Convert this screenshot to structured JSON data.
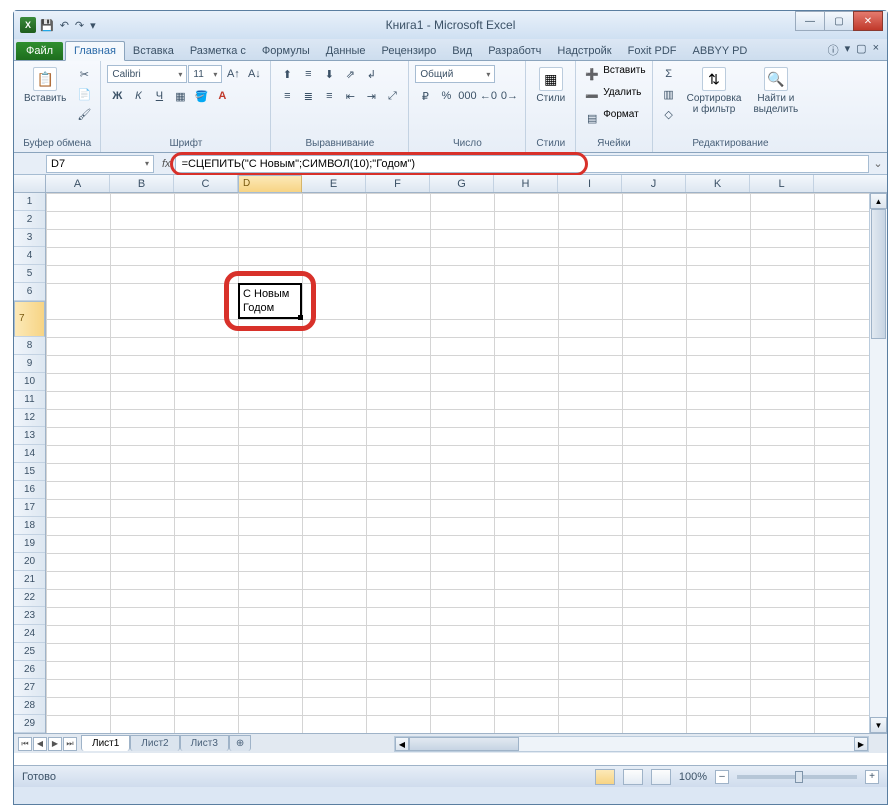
{
  "title": "Книга1 - Microsoft Excel",
  "qat": {
    "xl": "X",
    "save": "💾",
    "undo": "↶",
    "redo": "↷",
    "dd": "▾"
  },
  "tabs": {
    "file": "Файл",
    "items": [
      "Главная",
      "Вставка",
      "Разметка с",
      "Формулы",
      "Данные",
      "Рецензиро",
      "Вид",
      "Разработч",
      "Надстройк",
      "Foxit PDF",
      "ABBYY PD"
    ],
    "active": 0
  },
  "help": {
    "q": "ⓘ",
    "min": "▾",
    "rest": "▢",
    "close": "×"
  },
  "winbtns": {
    "min": "—",
    "max": "▢",
    "close": "✕"
  },
  "ribbon": {
    "clipboard": {
      "paste": "Вставить",
      "label": "Буфер обмена",
      "cut": "✂",
      "copy": "📄",
      "brush": "🖌"
    },
    "font": {
      "name": "Calibri",
      "size": "11",
      "label": "Шрифт",
      "bold": "Ж",
      "italic": "К",
      "underline": "Ч",
      "border": "▦",
      "fill": "🪣",
      "color": "A"
    },
    "align": {
      "label": "Выравнивание",
      "wrap": "↲",
      "merge": "⤢"
    },
    "number": {
      "format": "Общий",
      "label": "Число",
      "pct": "%",
      "comma": "000",
      "dec1": "←0",
      "dec2": "0→",
      "cur": "₽"
    },
    "styles": {
      "label": "Стили",
      "btn": "Стили",
      "cond": "▦"
    },
    "cells": {
      "insert": "Вставить",
      "delete": "Удалить",
      "format": "Формат",
      "label": "Ячейки"
    },
    "editing": {
      "sum": "Σ",
      "fill": "▥",
      "clear": "◇",
      "sort": "Сортировка\nи фильтр",
      "find": "Найти и\nвыделить",
      "label": "Редактирование"
    }
  },
  "namebox": "D7",
  "formula": "=СЦЕПИТЬ(\"С Новым\";СИМВОЛ(10);\"Годом\")",
  "fx": "fx",
  "columns": [
    "A",
    "B",
    "C",
    "D",
    "E",
    "F",
    "G",
    "H",
    "I",
    "J",
    "K",
    "L"
  ],
  "rows": [
    "1",
    "2",
    "3",
    "4",
    "5",
    "6",
    "7",
    "8",
    "9",
    "10",
    "11",
    "12",
    "13",
    "14",
    "15",
    "16",
    "17",
    "18",
    "19",
    "20",
    "21",
    "22",
    "23",
    "24",
    "25",
    "26",
    "27",
    "28",
    "29"
  ],
  "selectedColIndex": 3,
  "selectedRowIndex": 6,
  "cell": {
    "line1": "С Новым",
    "line2": "Годом"
  },
  "sheets": {
    "active": "Лист1",
    "others": [
      "Лист2",
      "Лист3"
    ],
    "new": "⊕"
  },
  "status": {
    "ready": "Готово",
    "zoom": "100%",
    "minus": "–",
    "plus": "+"
  }
}
